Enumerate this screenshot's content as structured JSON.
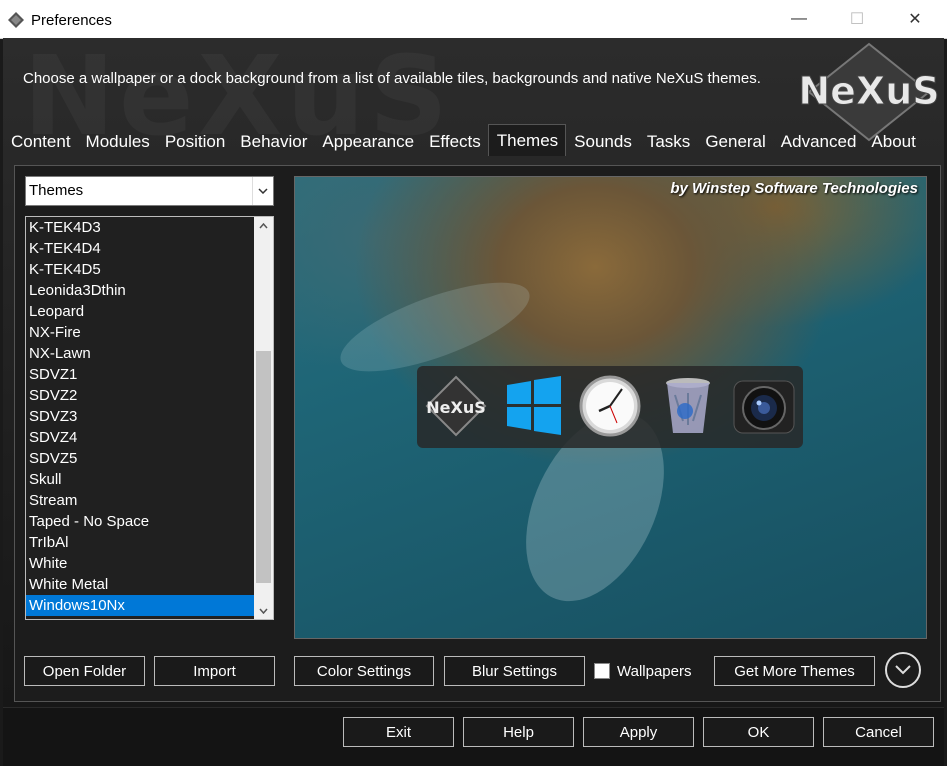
{
  "window": {
    "title": "Preferences",
    "min_glyph": "—",
    "max_glyph": "☐",
    "close_glyph": "✕"
  },
  "header": {
    "description": "Choose a wallpaper or a dock background from a list of available tiles, backgrounds and native NeXuS themes.",
    "logo_text": "NeXuS",
    "watermark": "NeXuS"
  },
  "tabs": [
    {
      "label": "Content"
    },
    {
      "label": "Modules"
    },
    {
      "label": "Position"
    },
    {
      "label": "Behavior"
    },
    {
      "label": "Appearance"
    },
    {
      "label": "Effects"
    },
    {
      "label": "Themes",
      "active": true
    },
    {
      "label": "Sounds"
    },
    {
      "label": "Tasks"
    },
    {
      "label": "General"
    },
    {
      "label": "Advanced"
    },
    {
      "label": "About"
    }
  ],
  "category_select": {
    "value": "Themes"
  },
  "theme_list": {
    "items": [
      "K-TEK4D3",
      "K-TEK4D4",
      "K-TEK4D5",
      "Leonida3Dthin",
      "Leopard",
      "NX-Fire",
      "NX-Lawn",
      "SDVZ1",
      "SDVZ2",
      "SDVZ3",
      "SDVZ4",
      "SDVZ5",
      "Skull",
      "Stream",
      "Taped - No Space",
      "TrIbAl",
      "White",
      "White Metal",
      "Windows10Nx"
    ],
    "selected": "Windows10Nx",
    "scroll_position": 0.93
  },
  "preview": {
    "credit": "by Winstep Software Technologies",
    "dock_logo_text": "NeXuS",
    "dock_icons": [
      "nexus-logo-icon",
      "windows-logo-icon",
      "clock-icon",
      "recycle-bin-icon",
      "camera-icon"
    ]
  },
  "buttons": {
    "open_folder": "Open Folder",
    "import": "Import",
    "color_settings": "Color Settings",
    "blur_settings": "Blur Settings",
    "wallpapers": "Wallpapers",
    "get_more_themes": "Get More Themes",
    "exit": "Exit",
    "help": "Help",
    "apply": "Apply",
    "ok": "OK",
    "cancel": "Cancel"
  },
  "wallpapers_checked": false,
  "colors": {
    "accent": "#0078d7",
    "panel_bg": "#1c1c1c",
    "text": "#ffffff"
  }
}
